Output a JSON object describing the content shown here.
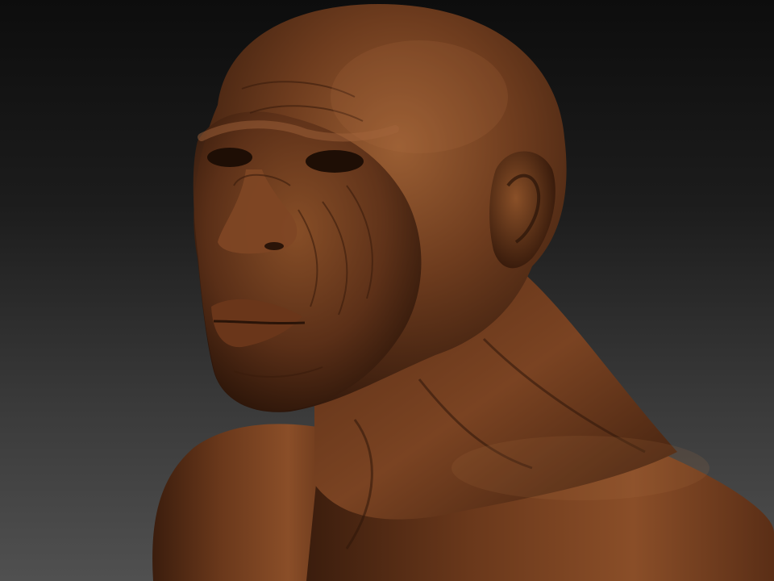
{
  "scene": {
    "subject": "sculpted-bust",
    "material_color": "#6b3a1f",
    "highlight_color": "#a5683a",
    "shadow_color": "#2a1408",
    "background_top": "#0d0d0d",
    "background_bottom": "#505050"
  }
}
